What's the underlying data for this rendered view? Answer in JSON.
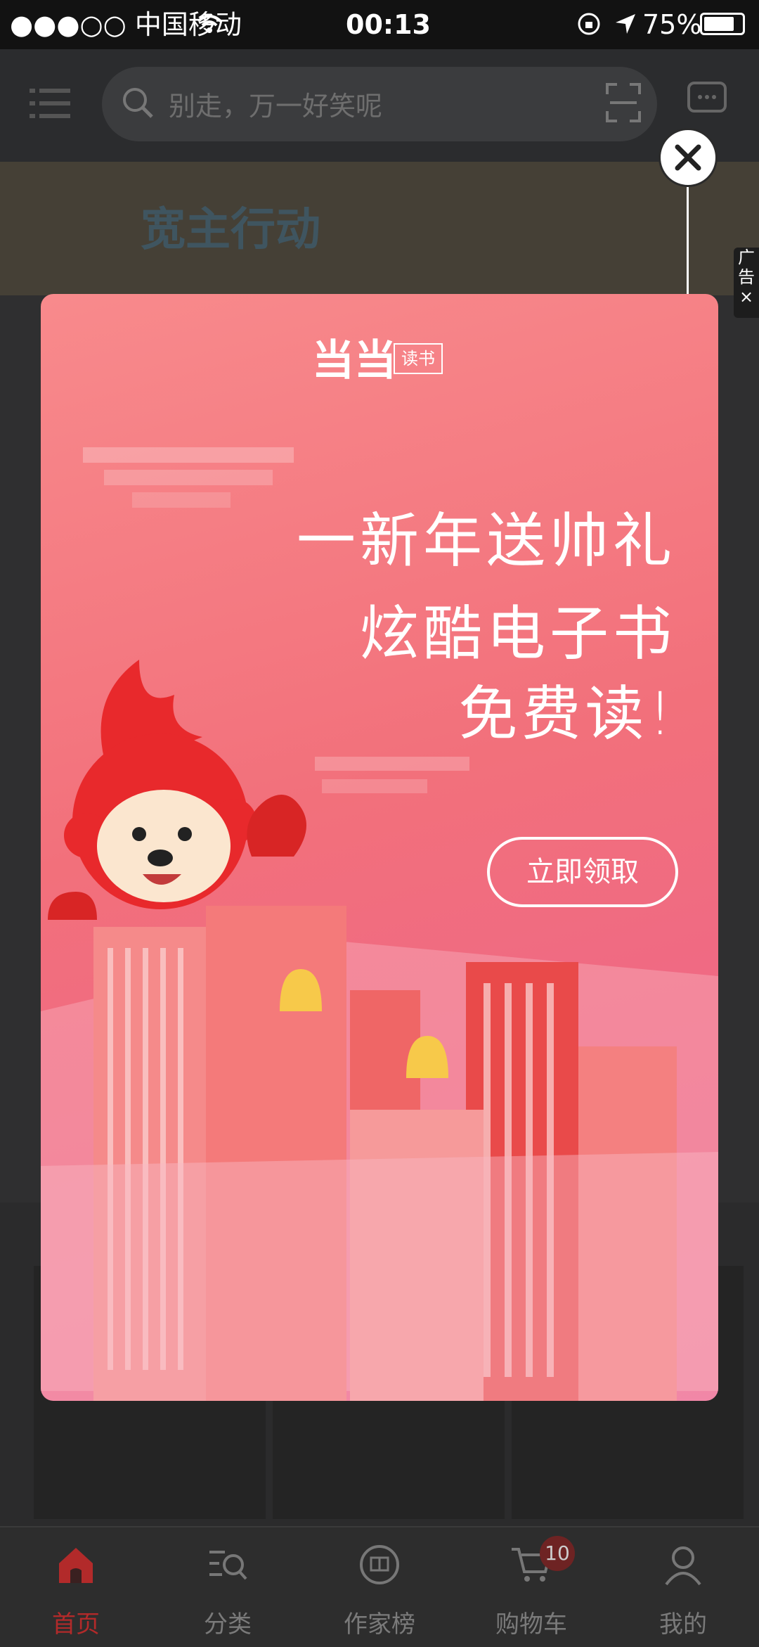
{
  "status_bar": {
    "carrier": "●●●○○ 中国移动",
    "time": "00:13",
    "battery": "75%",
    "wifi_icon": "wifi-icon",
    "location_icon": "location-arrow-icon",
    "lock_icon": "rotation-lock-icon"
  },
  "header": {
    "search_placeholder": "别走，万一好笑呢",
    "menu_icon": "menu-icon",
    "scan_icon": "scan-icon",
    "message_icon": "message-icon"
  },
  "hero": {
    "text": "宽主行动"
  },
  "ad": {
    "tag": "广告×",
    "logo_text": "当当",
    "logo_tag": "读书",
    "title_lines": [
      "一新年送帅礼",
      "炫酷电子书",
      "免费读!"
    ],
    "claim_button": "立即领取",
    "close_icon": "close-icon"
  },
  "tabbar": {
    "tabs": [
      {
        "label": "首页",
        "icon": "home-icon",
        "active": true
      },
      {
        "label": "分类",
        "icon": "category-search-icon",
        "active": false
      },
      {
        "label": "作家榜",
        "icon": "book-icon",
        "active": false
      },
      {
        "label": "购物车",
        "icon": "cart-icon",
        "active": false,
        "badge": "10"
      },
      {
        "label": "我的",
        "icon": "user-icon",
        "active": false
      }
    ]
  },
  "colors": {
    "accent": "#b22a2a",
    "popup_top": "#f88a8c",
    "popup_bottom": "#ec6090"
  }
}
